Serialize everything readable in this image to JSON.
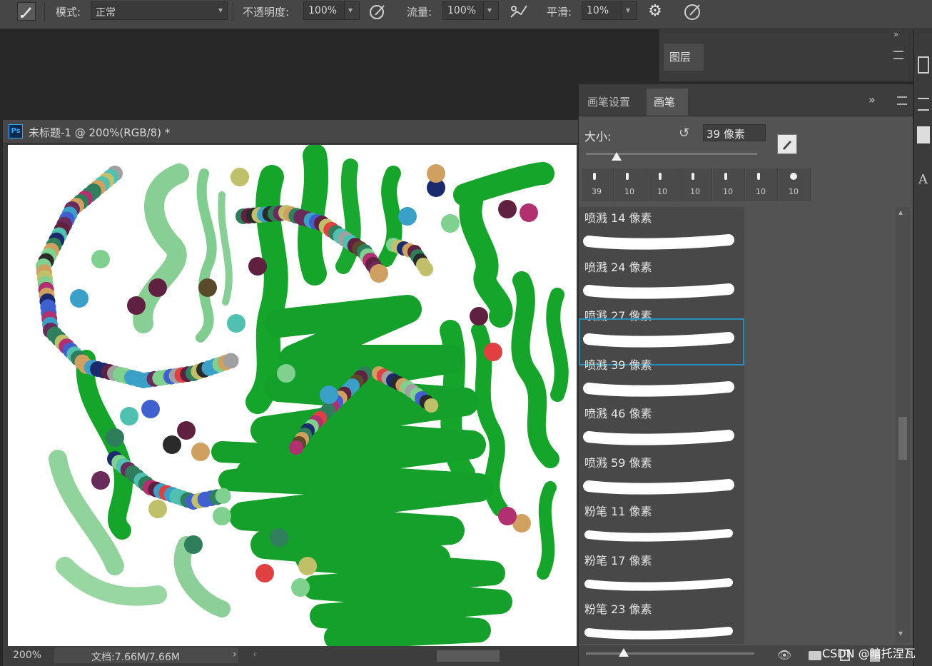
{
  "options_bar": {
    "mode_label": "模式:",
    "mode_value": "正常",
    "opacity_label": "不透明度:",
    "opacity_value": "100%",
    "flow_label": "流量:",
    "flow_value": "100%",
    "smoothing_label": "平滑:",
    "smoothing_value": "10%"
  },
  "document": {
    "tab_title": "未标题-1 @ 200%(RGB/8) *",
    "app_badge": "Ps",
    "zoom": "200%",
    "doc_info": "文档:7.66M/7.66M"
  },
  "layers_panel": {
    "tab_label": "图层"
  },
  "brush_panel": {
    "tabs": [
      "画笔设置",
      "画笔"
    ],
    "active_tab_index": 1,
    "size_label": "大小:",
    "size_value": "39 像素",
    "size_slider_fraction": 0.18,
    "recent_brushes": [
      "39",
      "10",
      "10",
      "10",
      "10",
      "10",
      "10"
    ],
    "presets": [
      {
        "label": "喷溅 14 像素"
      },
      {
        "label": "喷溅 24 像素"
      },
      {
        "label": "喷溅 27 像素"
      },
      {
        "label": "喷溅 39 像素",
        "selected": true
      },
      {
        "label": "喷溅 46 像素"
      },
      {
        "label": "喷溅 59 像素"
      },
      {
        "label": "粉笔 11 像素"
      },
      {
        "label": "粉笔 17 像素"
      },
      {
        "label": "粉笔 23 像素"
      }
    ]
  },
  "colors": {
    "brush_green": "#16a52b",
    "selection_blue": "#2a8fb8",
    "panel_bg": "#535353"
  },
  "watermark": "CSDN @暗托涅瓦"
}
